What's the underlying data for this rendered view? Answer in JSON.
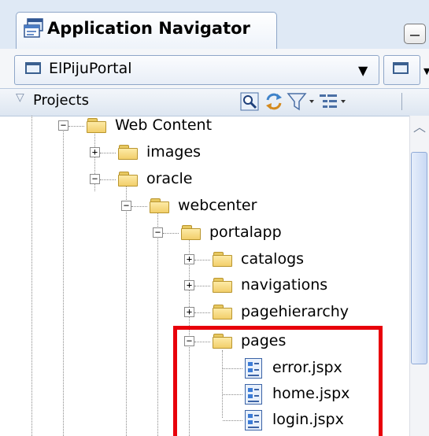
{
  "panel": {
    "title": "Application Navigator"
  },
  "application": {
    "name": "ElPijuPortal"
  },
  "projects": {
    "label": "Projects"
  },
  "tree": {
    "web_content": "Web Content",
    "images": "images",
    "oracle": "oracle",
    "webcenter": "webcenter",
    "portalapp": "portalapp",
    "catalogs": "catalogs",
    "navigations": "navigations",
    "pagehierarchy": "pagehierarchy",
    "pages": "pages",
    "files": [
      "error.jspx",
      "home.jspx",
      "login.jspx"
    ]
  },
  "icons": {
    "tab": "navigator-icon",
    "app": "window-icon",
    "find": "find-icon",
    "refresh": "refresh-icon",
    "filter": "filter-icon",
    "options": "tree-options-icon"
  },
  "colors": {
    "highlight": "#e8000b",
    "folder": "#f2cf6b",
    "header": "#dfe9f5"
  }
}
